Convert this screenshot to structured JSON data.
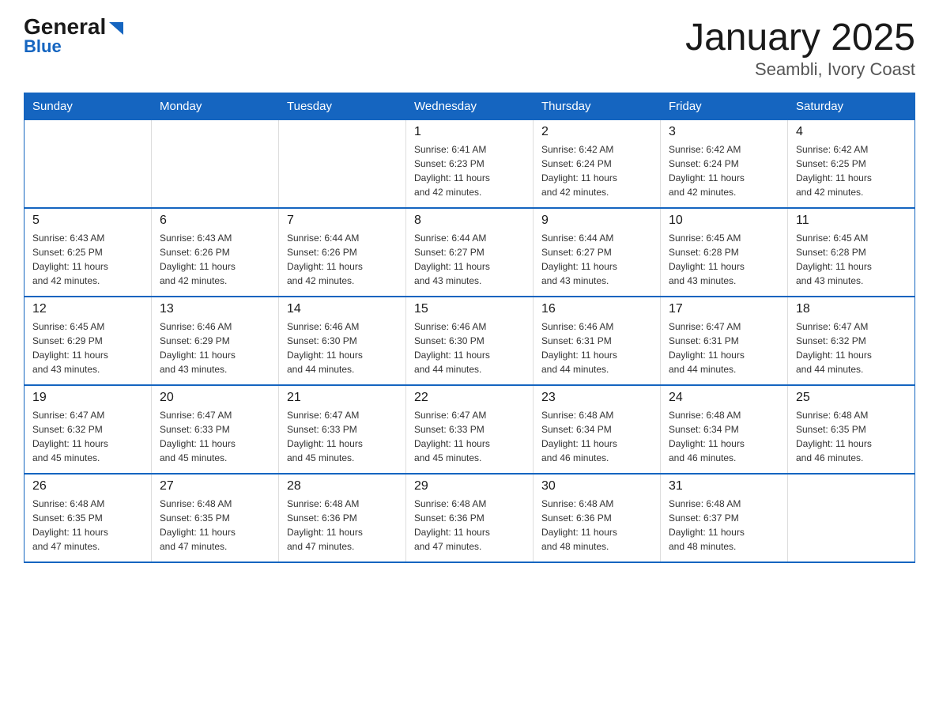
{
  "header": {
    "logo_general": "General",
    "logo_blue": "Blue",
    "month": "January 2025",
    "location": "Seambli, Ivory Coast"
  },
  "days_of_week": [
    "Sunday",
    "Monday",
    "Tuesday",
    "Wednesday",
    "Thursday",
    "Friday",
    "Saturday"
  ],
  "weeks": [
    [
      {
        "day": "",
        "info": ""
      },
      {
        "day": "",
        "info": ""
      },
      {
        "day": "",
        "info": ""
      },
      {
        "day": "1",
        "info": "Sunrise: 6:41 AM\nSunset: 6:23 PM\nDaylight: 11 hours\nand 42 minutes."
      },
      {
        "day": "2",
        "info": "Sunrise: 6:42 AM\nSunset: 6:24 PM\nDaylight: 11 hours\nand 42 minutes."
      },
      {
        "day": "3",
        "info": "Sunrise: 6:42 AM\nSunset: 6:24 PM\nDaylight: 11 hours\nand 42 minutes."
      },
      {
        "day": "4",
        "info": "Sunrise: 6:42 AM\nSunset: 6:25 PM\nDaylight: 11 hours\nand 42 minutes."
      }
    ],
    [
      {
        "day": "5",
        "info": "Sunrise: 6:43 AM\nSunset: 6:25 PM\nDaylight: 11 hours\nand 42 minutes."
      },
      {
        "day": "6",
        "info": "Sunrise: 6:43 AM\nSunset: 6:26 PM\nDaylight: 11 hours\nand 42 minutes."
      },
      {
        "day": "7",
        "info": "Sunrise: 6:44 AM\nSunset: 6:26 PM\nDaylight: 11 hours\nand 42 minutes."
      },
      {
        "day": "8",
        "info": "Sunrise: 6:44 AM\nSunset: 6:27 PM\nDaylight: 11 hours\nand 43 minutes."
      },
      {
        "day": "9",
        "info": "Sunrise: 6:44 AM\nSunset: 6:27 PM\nDaylight: 11 hours\nand 43 minutes."
      },
      {
        "day": "10",
        "info": "Sunrise: 6:45 AM\nSunset: 6:28 PM\nDaylight: 11 hours\nand 43 minutes."
      },
      {
        "day": "11",
        "info": "Sunrise: 6:45 AM\nSunset: 6:28 PM\nDaylight: 11 hours\nand 43 minutes."
      }
    ],
    [
      {
        "day": "12",
        "info": "Sunrise: 6:45 AM\nSunset: 6:29 PM\nDaylight: 11 hours\nand 43 minutes."
      },
      {
        "day": "13",
        "info": "Sunrise: 6:46 AM\nSunset: 6:29 PM\nDaylight: 11 hours\nand 43 minutes."
      },
      {
        "day": "14",
        "info": "Sunrise: 6:46 AM\nSunset: 6:30 PM\nDaylight: 11 hours\nand 44 minutes."
      },
      {
        "day": "15",
        "info": "Sunrise: 6:46 AM\nSunset: 6:30 PM\nDaylight: 11 hours\nand 44 minutes."
      },
      {
        "day": "16",
        "info": "Sunrise: 6:46 AM\nSunset: 6:31 PM\nDaylight: 11 hours\nand 44 minutes."
      },
      {
        "day": "17",
        "info": "Sunrise: 6:47 AM\nSunset: 6:31 PM\nDaylight: 11 hours\nand 44 minutes."
      },
      {
        "day": "18",
        "info": "Sunrise: 6:47 AM\nSunset: 6:32 PM\nDaylight: 11 hours\nand 44 minutes."
      }
    ],
    [
      {
        "day": "19",
        "info": "Sunrise: 6:47 AM\nSunset: 6:32 PM\nDaylight: 11 hours\nand 45 minutes."
      },
      {
        "day": "20",
        "info": "Sunrise: 6:47 AM\nSunset: 6:33 PM\nDaylight: 11 hours\nand 45 minutes."
      },
      {
        "day": "21",
        "info": "Sunrise: 6:47 AM\nSunset: 6:33 PM\nDaylight: 11 hours\nand 45 minutes."
      },
      {
        "day": "22",
        "info": "Sunrise: 6:47 AM\nSunset: 6:33 PM\nDaylight: 11 hours\nand 45 minutes."
      },
      {
        "day": "23",
        "info": "Sunrise: 6:48 AM\nSunset: 6:34 PM\nDaylight: 11 hours\nand 46 minutes."
      },
      {
        "day": "24",
        "info": "Sunrise: 6:48 AM\nSunset: 6:34 PM\nDaylight: 11 hours\nand 46 minutes."
      },
      {
        "day": "25",
        "info": "Sunrise: 6:48 AM\nSunset: 6:35 PM\nDaylight: 11 hours\nand 46 minutes."
      }
    ],
    [
      {
        "day": "26",
        "info": "Sunrise: 6:48 AM\nSunset: 6:35 PM\nDaylight: 11 hours\nand 47 minutes."
      },
      {
        "day": "27",
        "info": "Sunrise: 6:48 AM\nSunset: 6:35 PM\nDaylight: 11 hours\nand 47 minutes."
      },
      {
        "day": "28",
        "info": "Sunrise: 6:48 AM\nSunset: 6:36 PM\nDaylight: 11 hours\nand 47 minutes."
      },
      {
        "day": "29",
        "info": "Sunrise: 6:48 AM\nSunset: 6:36 PM\nDaylight: 11 hours\nand 47 minutes."
      },
      {
        "day": "30",
        "info": "Sunrise: 6:48 AM\nSunset: 6:36 PM\nDaylight: 11 hours\nand 48 minutes."
      },
      {
        "day": "31",
        "info": "Sunrise: 6:48 AM\nSunset: 6:37 PM\nDaylight: 11 hours\nand 48 minutes."
      },
      {
        "day": "",
        "info": ""
      }
    ]
  ]
}
